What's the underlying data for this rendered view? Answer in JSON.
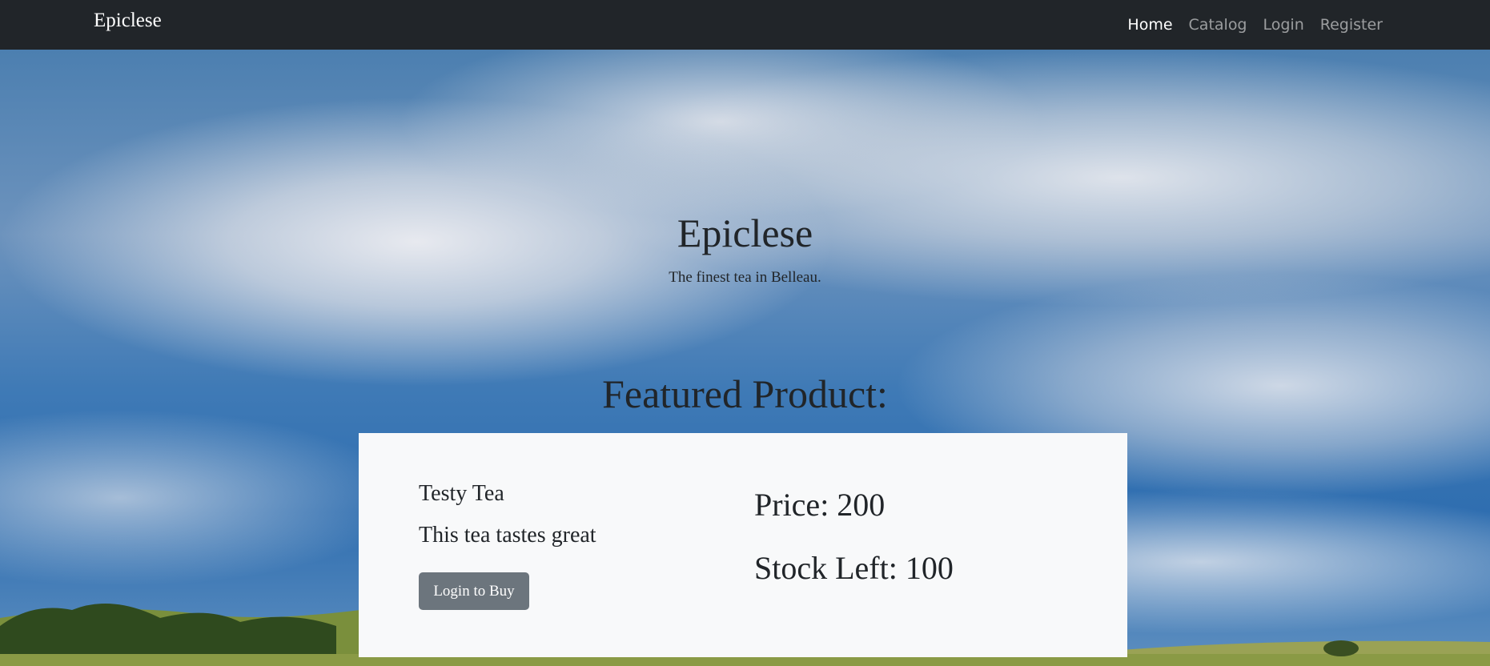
{
  "navbar": {
    "brand": "Epiclese",
    "links": [
      {
        "label": "Home",
        "active": true
      },
      {
        "label": "Catalog",
        "active": false
      },
      {
        "label": "Login",
        "active": false
      },
      {
        "label": "Register",
        "active": false
      }
    ]
  },
  "hero": {
    "title": "Epiclese",
    "subtitle": "The finest tea in Belleau."
  },
  "featured": {
    "heading": "Featured Product:",
    "product": {
      "name": "Testy Tea",
      "description": "This tea tastes great",
      "button_label": "Login to Buy",
      "price": "Price: 200",
      "stock": "Stock Left: 100"
    }
  },
  "colors": {
    "navbar_bg": "#212529",
    "card_bg": "#f8f9fa",
    "button_bg": "#6c757d",
    "text": "#212529"
  }
}
